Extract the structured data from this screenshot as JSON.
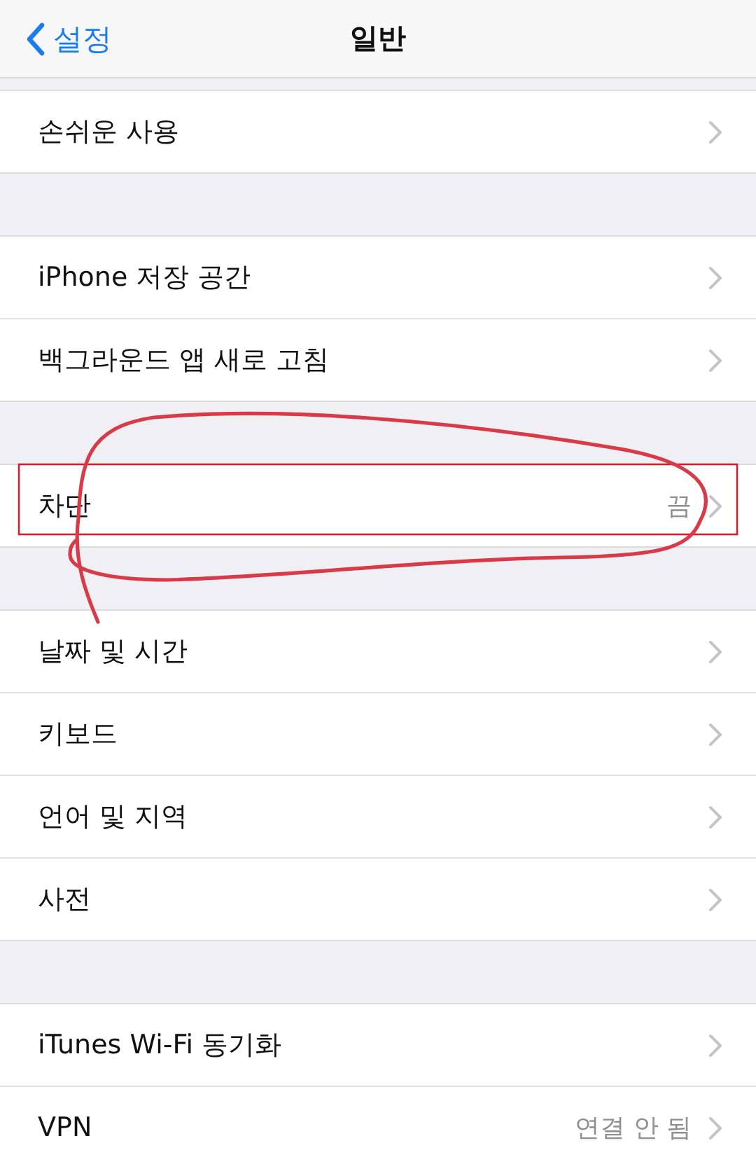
{
  "nav_bar": {
    "back_label": "설정",
    "title": "일반"
  },
  "sections": [
    {
      "rows": [
        {
          "label": "손쉬운 사용"
        }
      ]
    },
    {
      "rows": [
        {
          "label": "iPhone 저장 공간"
        },
        {
          "label": "백그라운드 앱 새로 고침"
        }
      ]
    },
    {
      "rows": [
        {
          "label": "차단",
          "value": "끔"
        }
      ]
    },
    {
      "rows": [
        {
          "label": "날짜 및 시간"
        },
        {
          "label": "키보드"
        },
        {
          "label": "언어 및 지역"
        },
        {
          "label": "사전"
        }
      ]
    },
    {
      "rows": [
        {
          "label": "iTunes Wi-Fi 동기화"
        },
        {
          "label": "VPN",
          "value": "연결 안 됨"
        }
      ]
    }
  ],
  "annotations": [
    {
      "kind": "rectangle",
      "color": "#d0202a"
    },
    {
      "kind": "scribble",
      "color": "#d83a48"
    }
  ]
}
